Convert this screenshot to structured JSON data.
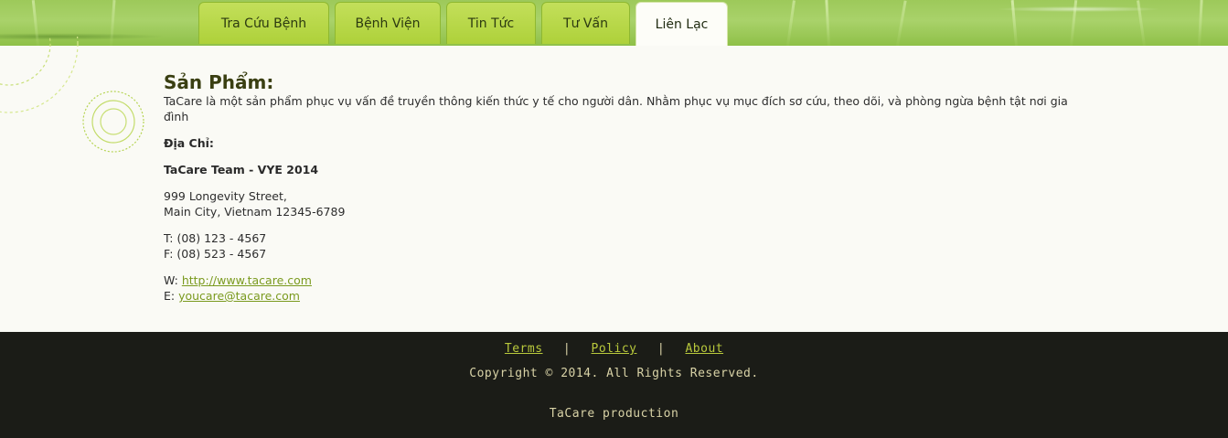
{
  "header": {
    "tabs": [
      {
        "label": "Tra Cứu Bệnh",
        "active": false
      },
      {
        "label": "Bệnh Viện",
        "active": false
      },
      {
        "label": "Tin Tức",
        "active": false
      },
      {
        "label": "Tư Vấn",
        "active": false
      },
      {
        "label": "Liên Lạc",
        "active": true
      }
    ]
  },
  "main": {
    "title": "Sản Phẩm:",
    "intro": "TaCare là một sản phẩm phục vụ vấn đề truyền thông kiến thức y tế cho người dân. Nhằm phục vụ mục đích sơ cứu, theo dõi, và phòng ngừa bệnh tật nơi gia đình",
    "address_label": "Địa Chỉ:",
    "team": "TaCare Team - VYE 2014",
    "street": "999 Longevity Street,",
    "city": "Main City, Vietnam 12345-6789",
    "phone_label": "T:",
    "phone": "(08) 123 - 4567",
    "fax_label": "F:",
    "fax": "(08) 523 - 4567",
    "web_label": "W:",
    "web_link": "http://www.tacare.com",
    "email_label": "E:",
    "email_link": "youcare@tacare.com"
  },
  "footer": {
    "links": [
      "Terms",
      "Policy",
      "About"
    ],
    "separator": "|",
    "copyright": "Copyright © 2014. All Rights Reserved.",
    "production": "TaCare production"
  },
  "colors": {
    "tab_bg": "#b5d743",
    "footer_bg": "#1b1c17",
    "link": "#7a9a1e",
    "footer_link": "#b9c93c"
  }
}
